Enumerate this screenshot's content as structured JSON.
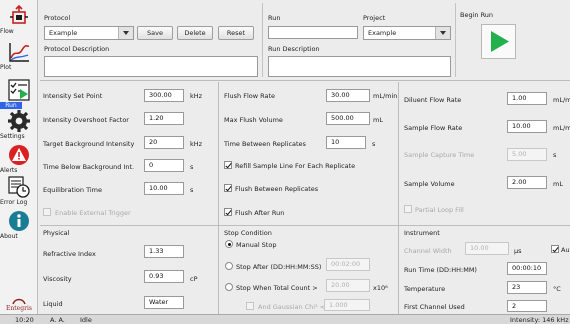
{
  "nav": {
    "flow": "Flow",
    "plot": "Plot",
    "run": "Run",
    "settings": "Settings",
    "alerts": "Alerts",
    "error_log": "Error Log",
    "about": "About",
    "logo_text": "Entegris"
  },
  "top": {
    "protocol_label": "Protocol",
    "protocol_value": "Example",
    "save": "Save",
    "delete": "Delete",
    "reset": "Reset",
    "protocol_description_label": "Protocol Description",
    "protocol_description_value": "",
    "run_label": "Run",
    "run_value": "",
    "project_label": "Project",
    "project_value": "Example",
    "run_description_label": "Run Description",
    "run_description_value": "",
    "begin_run_label": "Begin Run"
  },
  "col1": {
    "intensity_set_point_label": "Intensity Set Point",
    "intensity_set_point_value": "300.00",
    "intensity_set_point_unit": "kHz",
    "intensity_overshoot_label": "Intensity Overshoot Factor",
    "intensity_overshoot_value": "1.20",
    "target_bg_label": "Target Background Intensity",
    "target_bg_value": "20",
    "target_bg_unit": "kHz",
    "time_below_bg_label": "Time Below Background Int.",
    "time_below_bg_value": "0",
    "time_below_bg_unit": "s",
    "equilibration_label": "Equilibration Time",
    "equilibration_value": "10.00",
    "equilibration_unit": "s",
    "external_trigger_label": "Enable External Trigger"
  },
  "col2": {
    "flush_flow_rate_label": "Flush Flow Rate",
    "flush_flow_rate_value": "30.00",
    "flush_flow_rate_unit": "mL/min",
    "max_flush_volume_label": "Max Flush Volume",
    "max_flush_volume_value": "500.00",
    "max_flush_volume_unit": "mL",
    "time_between_label": "Time Between Replicates",
    "time_between_value": "10",
    "time_between_unit": "s",
    "refill_label": "Refill Sample Line For Each Replicate",
    "flush_between_label": "Flush Between Replicates",
    "flush_after_label": "Flush After Run"
  },
  "col3": {
    "diluent_flow_rate_label": "Diluent Flow Rate",
    "diluent_flow_rate_value": "1.00",
    "diluent_flow_rate_unit": "mL/min",
    "sample_flow_rate_label": "Sample Flow Rate",
    "sample_flow_rate_value": "10.00",
    "sample_flow_rate_unit": "mL/min",
    "sample_capture_time_label": "Sample Capture Time",
    "sample_capture_time_value": "5.00",
    "sample_capture_time_unit": "s",
    "sample_volume_label": "Sample Volume",
    "sample_volume_value": "2.00",
    "sample_volume_unit": "mL",
    "partial_loop_fill_label": "Partial Loop Fill"
  },
  "physical": {
    "title": "Physical",
    "refractive_index_label": "Refractive Index",
    "refractive_index_value": "1.33",
    "viscosity_label": "Viscosity",
    "viscosity_value": "0.93",
    "viscosity_unit": "cP",
    "liquid_label": "Liquid",
    "liquid_value": "Water"
  },
  "stop": {
    "title": "Stop Condition",
    "manual_label": "Manual Stop",
    "after_label": "Stop After (DD:HH:MM:SS)",
    "after_value": "00:02:00",
    "count_label": "Stop When Total Count >",
    "count_value": "20.00",
    "count_unit": "x10⁶",
    "gaussian_label": "And Gaussian Chi² <",
    "gaussian_value": "1.000"
  },
  "instrument": {
    "title": "Instrument",
    "channel_width_label": "Channel Width",
    "channel_width_value": "10.00",
    "channel_width_unit": "µs",
    "auto_label": "Aut",
    "run_time_label": "Run Time (DD:HH:MM)",
    "run_time_value": "00:00:10",
    "temperature_label": "Temperature",
    "temperature_value": "23",
    "temperature_unit": "°C",
    "first_channel_label": "First Channel Used",
    "first_channel_value": "2"
  },
  "status": {
    "time": "10:20",
    "user": "A. A.",
    "state": "Idle",
    "intensity": "Intensity: 146 kHz"
  },
  "colors": {
    "accent": "#2f64e8",
    "run_green": "#22b14c",
    "alert_red": "#d92121",
    "about_teal": "#1a7d96"
  }
}
